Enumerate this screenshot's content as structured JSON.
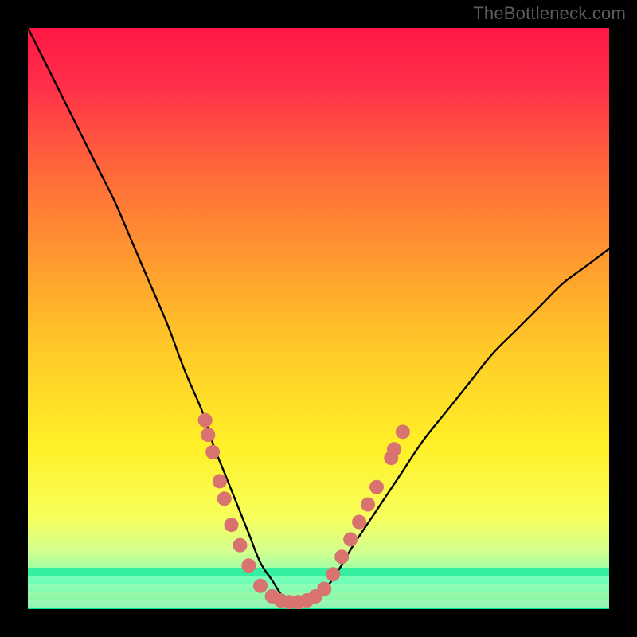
{
  "watermark": "TheBottleneck.com",
  "chart_data": {
    "type": "line",
    "title": "",
    "xlabel": "",
    "ylabel": "",
    "xlim": [
      0,
      100
    ],
    "ylim": [
      0,
      100
    ],
    "curve": {
      "name": "bottleneck-curve",
      "x": [
        0,
        3,
        6,
        9,
        12,
        15,
        18,
        21,
        24,
        27,
        30,
        32,
        34,
        36,
        38,
        40,
        42,
        44,
        46,
        48,
        50,
        53,
        56,
        60,
        64,
        68,
        72,
        76,
        80,
        84,
        88,
        92,
        96,
        100
      ],
      "y": [
        100,
        94,
        88,
        82,
        76,
        70,
        63,
        56,
        49,
        41,
        34,
        28,
        23,
        18,
        13,
        8,
        5,
        2,
        1,
        1,
        2,
        6,
        11,
        17,
        23,
        29,
        34,
        39,
        44,
        48,
        52,
        56,
        59,
        62
      ]
    },
    "markers": {
      "name": "dots",
      "color": "#d9736f",
      "radius": 9,
      "points": [
        {
          "x": 30.5,
          "y": 32.5
        },
        {
          "x": 31.0,
          "y": 30.0
        },
        {
          "x": 31.8,
          "y": 27.0
        },
        {
          "x": 33.0,
          "y": 22.0
        },
        {
          "x": 33.8,
          "y": 19.0
        },
        {
          "x": 35.0,
          "y": 14.5
        },
        {
          "x": 36.5,
          "y": 11.0
        },
        {
          "x": 38.0,
          "y": 7.5
        },
        {
          "x": 40.0,
          "y": 4.0
        },
        {
          "x": 42.0,
          "y": 2.2
        },
        {
          "x": 43.5,
          "y": 1.5
        },
        {
          "x": 45.0,
          "y": 1.2
        },
        {
          "x": 46.5,
          "y": 1.2
        },
        {
          "x": 48.0,
          "y": 1.5
        },
        {
          "x": 49.5,
          "y": 2.2
        },
        {
          "x": 51.0,
          "y": 3.5
        },
        {
          "x": 52.5,
          "y": 6.0
        },
        {
          "x": 54.0,
          "y": 9.0
        },
        {
          "x": 55.5,
          "y": 12.0
        },
        {
          "x": 57.0,
          "y": 15.0
        },
        {
          "x": 58.5,
          "y": 18.0
        },
        {
          "x": 60.0,
          "y": 21.0
        },
        {
          "x": 62.5,
          "y": 26.0
        },
        {
          "x": 63.0,
          "y": 27.5
        },
        {
          "x": 64.5,
          "y": 30.5
        }
      ]
    },
    "gradient_stops": [
      {
        "offset": 0.0,
        "color": "#ff1744"
      },
      {
        "offset": 0.1,
        "color": "#ff2f4a"
      },
      {
        "offset": 0.25,
        "color": "#ff6a3a"
      },
      {
        "offset": 0.4,
        "color": "#ff9a2f"
      },
      {
        "offset": 0.55,
        "color": "#ffc928"
      },
      {
        "offset": 0.72,
        "color": "#fff028"
      },
      {
        "offset": 0.84,
        "color": "#f8ff5a"
      },
      {
        "offset": 0.9,
        "color": "#d4ff8e"
      },
      {
        "offset": 0.95,
        "color": "#7dffb0"
      },
      {
        "offset": 1.0,
        "color": "#00e58c"
      }
    ],
    "green_band": {
      "from_y": 0,
      "to_y": 5
    }
  }
}
